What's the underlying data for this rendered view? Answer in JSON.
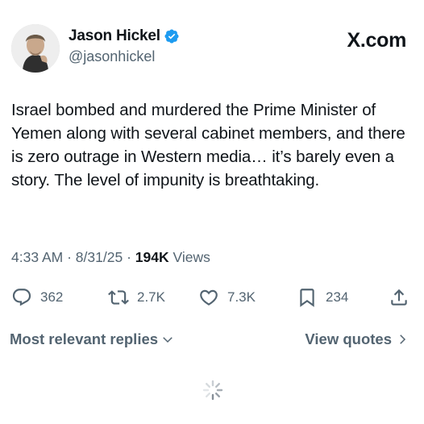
{
  "author": {
    "name": "Jason Hickel",
    "handle": "@jasonhickel",
    "verified": true
  },
  "brand": "X.com",
  "tweet": {
    "text": "Israel bombed and murdered the Prime Minister of Yemen along with several cabinet members, and there is zero outrage in Western media… it’s barely even a story. The level of impunity is breathtaking."
  },
  "meta": {
    "time": "4:33 AM",
    "separator": "·",
    "date": "8/31/25",
    "views_count": "194K",
    "views_label": "Views"
  },
  "stats": {
    "replies": "362",
    "reposts": "2.7K",
    "likes": "7.3K",
    "bookmarks": "234"
  },
  "replies_bar": {
    "sort_label": "Most relevant replies",
    "quotes_label": "View quotes"
  },
  "colors": {
    "text": "#0f1419",
    "secondary": "#536471",
    "verified": "#1d9bf0",
    "background": "#ffffff"
  }
}
